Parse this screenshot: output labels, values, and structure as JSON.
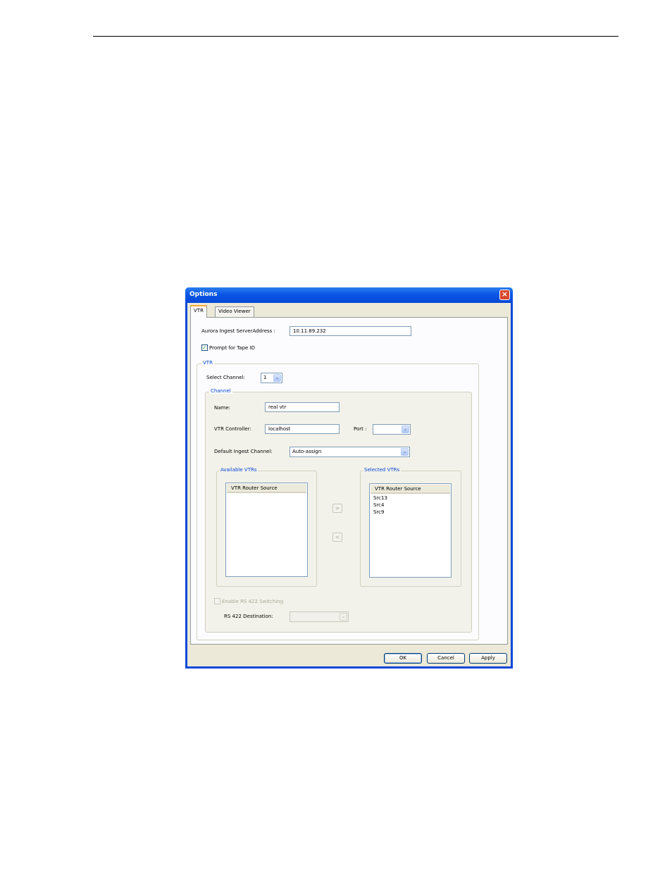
{
  "dialog": {
    "title": "Options",
    "close_glyph": "×",
    "close_icon": "close-icon"
  },
  "tabs": [
    {
      "label": "VTR",
      "active": true
    },
    {
      "label": "Video Viewer",
      "active": false
    }
  ],
  "server": {
    "label": "Aurora Ingest ServerAddress :",
    "value": "10.11.89.232"
  },
  "prompt_tape_id": {
    "label": "Prompt for Tape ID",
    "checked": true,
    "check_glyph": "✓"
  },
  "vtr_group": {
    "title": "VTR",
    "select_channel_label": "Select Channel:",
    "select_channel_value": "1"
  },
  "channel_group": {
    "title": "Channel",
    "name_label": "Name:",
    "name_value": "real vtr",
    "controller_label": "VTR Controller:",
    "controller_value": "localhost",
    "port_label": "Port :",
    "port_value": "",
    "ingest_label": "Default Ingest Channel:",
    "ingest_value": "Auto-assign"
  },
  "available_vtrs": {
    "title": "Available VTRs",
    "column": "VTR Router Source",
    "items": []
  },
  "selected_vtrs": {
    "title": "Selected VTRs",
    "column": "VTR Router Source",
    "items": [
      "Src13",
      "Src4",
      "Src9"
    ]
  },
  "move_buttons": {
    "add": ">",
    "remove": "<"
  },
  "rs422": {
    "enable_label": "Enable RS 422 Switching",
    "enabled": false,
    "destination_label": "RS 422 Destination:",
    "destination_value": ""
  },
  "buttons": {
    "ok": "OK",
    "cancel": "Cancel",
    "apply": "Apply"
  },
  "dropdown_arrow": "⌄",
  "colors": {
    "titlebar": "#0a56e6",
    "accent_tab": "#f7a932",
    "group_title": "#0046d5",
    "check": "#21a121"
  }
}
